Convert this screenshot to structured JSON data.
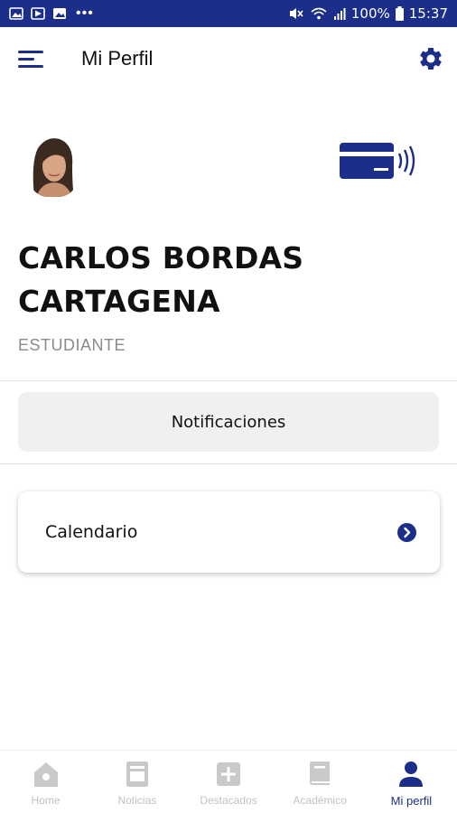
{
  "status_bar": {
    "battery": "100%",
    "time": "15:37",
    "left_icons": [
      "gallery-icon",
      "play-store-icon",
      "photo-icon",
      "more-dots-icon"
    ],
    "right_icons": [
      "mute-icon",
      "wifi-icon",
      "signal-icon",
      "battery-icon"
    ]
  },
  "header": {
    "title": "Mi Perfil",
    "menu_icon": "menu-icon",
    "settings_icon": "gear-icon"
  },
  "profile": {
    "name": "CARLOS BORDAS CARTAGENA",
    "role": "ESTUDIANTE",
    "avatar_icon": "avatar",
    "card_icon": "contactless-card-icon"
  },
  "actions": {
    "notifications_label": "Notificaciones",
    "calendar_label": "Calendario"
  },
  "bottom_nav": {
    "items": [
      {
        "label": "Home",
        "icon": "home-icon",
        "active": false
      },
      {
        "label": "Noticias",
        "icon": "news-icon",
        "active": false
      },
      {
        "label": "Destacados",
        "icon": "plus-icon",
        "active": false
      },
      {
        "label": "Académico",
        "icon": "book-icon",
        "active": false
      },
      {
        "label": "Mi perfil",
        "icon": "person-icon",
        "active": true
      }
    ]
  },
  "colors": {
    "primary": "#1b2f8a",
    "status_bar": "#1b2f8a",
    "inactive": "#c2c2c2",
    "muted_text": "#8a8a8a",
    "button_bg": "#f0f0f0"
  }
}
